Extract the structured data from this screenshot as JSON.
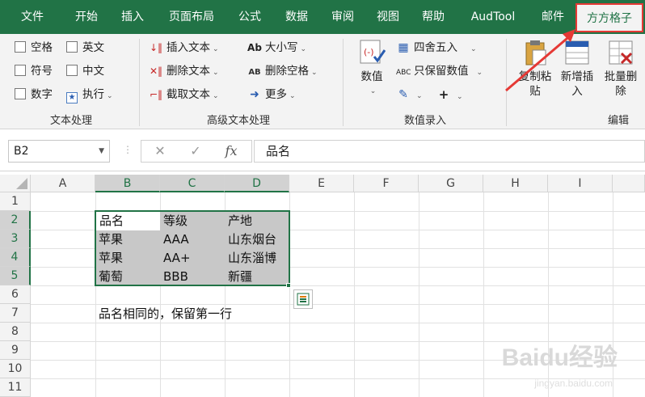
{
  "tabs": [
    {
      "label": "文件"
    },
    {
      "label": "开始"
    },
    {
      "label": "插入"
    },
    {
      "label": "页面布局"
    },
    {
      "label": "公式"
    },
    {
      "label": "数据"
    },
    {
      "label": "审阅"
    },
    {
      "label": "视图"
    },
    {
      "label": "帮助"
    },
    {
      "label": "AudTool"
    },
    {
      "label": "邮件"
    },
    {
      "label": "方方格子"
    }
  ],
  "ribbon": {
    "text_group": {
      "label": "文本处理",
      "items": [
        "空格",
        "英文",
        "符号",
        "中文",
        "数字",
        "执行"
      ]
    },
    "advanced_group": {
      "label": "高级文本处理",
      "items": [
        "插入文本",
        "删除文本",
        "截取文本",
        "大小写",
        "删除空格",
        "更多"
      ]
    },
    "numeric_group": {
      "label": "数值录入",
      "value_button": "数值",
      "items": [
        "四舍五入",
        "只保留数值"
      ]
    },
    "edit_group": {
      "label": "编辑",
      "copy_paste": "复制粘贴",
      "add_insert": "新增插入",
      "batch_delete": "批量删除"
    }
  },
  "formula_bar": {
    "name_box": "B2",
    "fx_label": "fx",
    "content": "品名"
  },
  "grid": {
    "columns": [
      "A",
      "B",
      "C",
      "D",
      "E",
      "F",
      "G",
      "H",
      "I"
    ],
    "rows": [
      "1",
      "2",
      "3",
      "4",
      "5",
      "6",
      "7",
      "8",
      "9",
      "10",
      "11"
    ],
    "table": [
      [
        "品名",
        "等级",
        "产地"
      ],
      [
        "苹果",
        "AAA",
        "山东烟台"
      ],
      [
        "苹果",
        "AA+",
        "山东淄博"
      ],
      [
        "葡萄",
        "BBB",
        "新疆"
      ]
    ],
    "note": "品名相同的，保留第一行"
  },
  "watermark": "Baidu经验",
  "watermark_url": "jingyan.baidu.com",
  "colors": {
    "excel_green": "#217346",
    "highlight_red": "#e53935",
    "cell_gray": "#c8c8c8"
  }
}
